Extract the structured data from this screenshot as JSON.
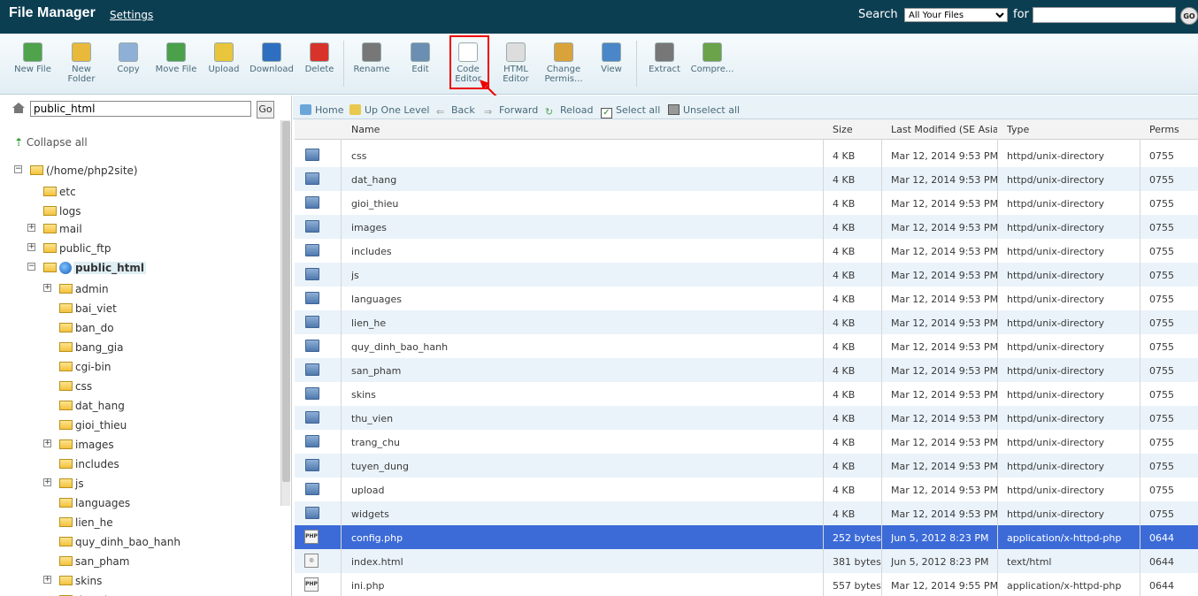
{
  "header": {
    "title": "File Manager",
    "settings": "Settings",
    "search_label": "Search",
    "search_scope": "All Your Files",
    "for_label": "for",
    "go": "GO"
  },
  "toolbar": [
    {
      "label": "New File",
      "icon": "new-file-icon"
    },
    {
      "label": "New Folder",
      "icon": "new-folder-icon"
    },
    {
      "label": "Copy",
      "icon": "copy-icon"
    },
    {
      "label": "Move File",
      "icon": "move-file-icon"
    },
    {
      "label": "Upload",
      "icon": "upload-icon"
    },
    {
      "label": "Download",
      "icon": "download-icon"
    },
    {
      "label": "Delete",
      "icon": "delete-icon"
    },
    {
      "label": "Rename",
      "icon": "rename-icon"
    },
    {
      "label": "Edit",
      "icon": "edit-icon"
    },
    {
      "label": "Code Editor",
      "icon": "code-editor-icon"
    },
    {
      "label": "HTML Editor",
      "icon": "html-editor-icon"
    },
    {
      "label": "Change Permis...",
      "icon": "change-permissions-icon"
    },
    {
      "label": "View",
      "icon": "view-icon"
    },
    {
      "label": "Extract",
      "icon": "extract-icon"
    },
    {
      "label": "Compre...",
      "icon": "compress-icon"
    }
  ],
  "left": {
    "path_value": "public_html",
    "go": "Go",
    "collapse_all": "Collapse all",
    "tree": [
      {
        "label": "(/home/php2site)",
        "expander": "−"
      },
      {
        "label": "etc"
      },
      {
        "label": "logs"
      },
      {
        "label": "mail",
        "expander": "+"
      },
      {
        "label": "public_ftp",
        "expander": "+"
      },
      {
        "label": "public_html",
        "expander": "−"
      },
      {
        "label": "admin",
        "expander": "+"
      },
      {
        "label": "bai_viet"
      },
      {
        "label": "ban_do"
      },
      {
        "label": "bang_gia"
      },
      {
        "label": "cgi-bin"
      },
      {
        "label": "css"
      },
      {
        "label": "dat_hang"
      },
      {
        "label": "gioi_thieu"
      },
      {
        "label": "images",
        "expander": "+"
      },
      {
        "label": "includes"
      },
      {
        "label": "js",
        "expander": "+"
      },
      {
        "label": "languages"
      },
      {
        "label": "lien_he"
      },
      {
        "label": "quy_dinh_bao_hanh"
      },
      {
        "label": "san_pham"
      },
      {
        "label": "skins",
        "expander": "+"
      },
      {
        "label": "thu_vien"
      }
    ]
  },
  "nav": {
    "home": "Home",
    "up": "Up One Level",
    "back": "Back",
    "forward": "Forward",
    "reload": "Reload",
    "select_all": "Select all",
    "unselect_all": "Unselect all"
  },
  "table": {
    "columns": [
      "Name",
      "Size",
      "Last Modified (SE Asia Standard Time)",
      "Type",
      "Perms"
    ],
    "rows": [
      {
        "name": "css",
        "size": "4 KB",
        "modified": "Mar 12, 2014 9:53 PM",
        "type": "httpd/unix-directory",
        "perms": "0755",
        "kind": "dir"
      },
      {
        "name": "dat_hang",
        "size": "4 KB",
        "modified": "Mar 12, 2014 9:53 PM",
        "type": "httpd/unix-directory",
        "perms": "0755",
        "kind": "dir"
      },
      {
        "name": "gioi_thieu",
        "size": "4 KB",
        "modified": "Mar 12, 2014 9:53 PM",
        "type": "httpd/unix-directory",
        "perms": "0755",
        "kind": "dir"
      },
      {
        "name": "images",
        "size": "4 KB",
        "modified": "Mar 12, 2014 9:53 PM",
        "type": "httpd/unix-directory",
        "perms": "0755",
        "kind": "dir"
      },
      {
        "name": "includes",
        "size": "4 KB",
        "modified": "Mar 12, 2014 9:53 PM",
        "type": "httpd/unix-directory",
        "perms": "0755",
        "kind": "dir"
      },
      {
        "name": "js",
        "size": "4 KB",
        "modified": "Mar 12, 2014 9:53 PM",
        "type": "httpd/unix-directory",
        "perms": "0755",
        "kind": "dir"
      },
      {
        "name": "languages",
        "size": "4 KB",
        "modified": "Mar 12, 2014 9:53 PM",
        "type": "httpd/unix-directory",
        "perms": "0755",
        "kind": "dir"
      },
      {
        "name": "lien_he",
        "size": "4 KB",
        "modified": "Mar 12, 2014 9:53 PM",
        "type": "httpd/unix-directory",
        "perms": "0755",
        "kind": "dir"
      },
      {
        "name": "quy_dinh_bao_hanh",
        "size": "4 KB",
        "modified": "Mar 12, 2014 9:53 PM",
        "type": "httpd/unix-directory",
        "perms": "0755",
        "kind": "dir"
      },
      {
        "name": "san_pham",
        "size": "4 KB",
        "modified": "Mar 12, 2014 9:53 PM",
        "type": "httpd/unix-directory",
        "perms": "0755",
        "kind": "dir"
      },
      {
        "name": "skins",
        "size": "4 KB",
        "modified": "Mar 12, 2014 9:53 PM",
        "type": "httpd/unix-directory",
        "perms": "0755",
        "kind": "dir"
      },
      {
        "name": "thu_vien",
        "size": "4 KB",
        "modified": "Mar 12, 2014 9:53 PM",
        "type": "httpd/unix-directory",
        "perms": "0755",
        "kind": "dir"
      },
      {
        "name": "trang_chu",
        "size": "4 KB",
        "modified": "Mar 12, 2014 9:53 PM",
        "type": "httpd/unix-directory",
        "perms": "0755",
        "kind": "dir"
      },
      {
        "name": "tuyen_dung",
        "size": "4 KB",
        "modified": "Mar 12, 2014 9:53 PM",
        "type": "httpd/unix-directory",
        "perms": "0755",
        "kind": "dir"
      },
      {
        "name": "upload",
        "size": "4 KB",
        "modified": "Mar 12, 2014 9:53 PM",
        "type": "httpd/unix-directory",
        "perms": "0755",
        "kind": "dir"
      },
      {
        "name": "widgets",
        "size": "4 KB",
        "modified": "Mar 12, 2014 9:53 PM",
        "type": "httpd/unix-directory",
        "perms": "0755",
        "kind": "dir"
      },
      {
        "name": "config.php",
        "size": "252 bytes",
        "modified": "Jun 5, 2012 8:23 PM",
        "type": "application/x-httpd-php",
        "perms": "0644",
        "kind": "php",
        "selected": true
      },
      {
        "name": "index.html",
        "size": "381 bytes",
        "modified": "Jun 5, 2012 8:23 PM",
        "type": "text/html",
        "perms": "0644",
        "kind": "html"
      },
      {
        "name": "ini.php",
        "size": "557 bytes",
        "modified": "Mar 12, 2014 9:55 PM",
        "type": "application/x-httpd-php",
        "perms": "0644",
        "kind": "php"
      }
    ]
  },
  "colors": {
    "header_bg": "#0c3e52",
    "selected_row": "#3c6bd8",
    "alt_row": "#eaf3fa",
    "highlight_box": "#ee0000"
  }
}
